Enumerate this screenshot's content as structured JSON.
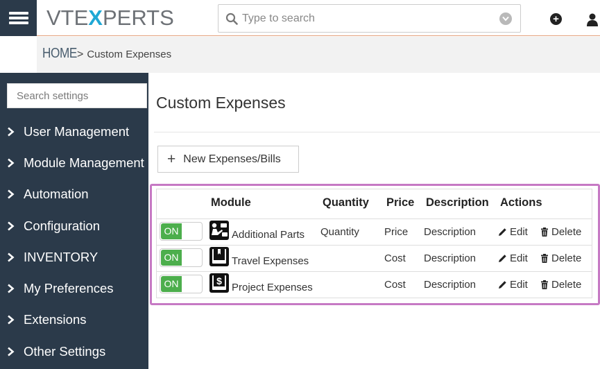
{
  "header": {
    "logo_left": "VTE",
    "logo_x": "X",
    "logo_right": "PERTS",
    "search_placeholder": "Type to search"
  },
  "breadcrumb": {
    "home": "HOME",
    "separator": ">",
    "current": "Custom Expenses"
  },
  "sidebar": {
    "search_placeholder": "Search settings",
    "items": [
      {
        "label": "User Management"
      },
      {
        "label": "Module Management"
      },
      {
        "label": "Automation"
      },
      {
        "label": "Configuration"
      },
      {
        "label": "INVENTORY"
      },
      {
        "label": "My Preferences"
      },
      {
        "label": "Extensions"
      },
      {
        "label": "Other Settings"
      }
    ]
  },
  "main": {
    "title": "Custom Expenses",
    "new_button": "New Expenses/Bills",
    "table": {
      "headers": [
        "Module",
        "Quantity",
        "Price",
        "Description",
        "Actions"
      ],
      "rows": [
        {
          "status": "ON",
          "icon": "parts-icon",
          "module": "Additional Parts",
          "quantity": "Quantity",
          "price": "Price",
          "description": "Description",
          "edit": "Edit",
          "delete": "Delete"
        },
        {
          "status": "ON",
          "icon": "book-icon",
          "module": "Travel Expenses",
          "quantity": "",
          "price": "Cost",
          "description": "Description",
          "edit": "Edit",
          "delete": "Delete"
        },
        {
          "status": "ON",
          "icon": "dollar-book-icon",
          "module": "Project Expenses",
          "quantity": "",
          "price": "Cost",
          "description": "Description",
          "edit": "Edit",
          "delete": "Delete"
        }
      ]
    }
  },
  "colors": {
    "sidebar_bg": "#2b3a4a",
    "logo_accent": "#1fa8d5",
    "toggle_on": "#4cae4c",
    "highlight_border": "#c679c4"
  }
}
